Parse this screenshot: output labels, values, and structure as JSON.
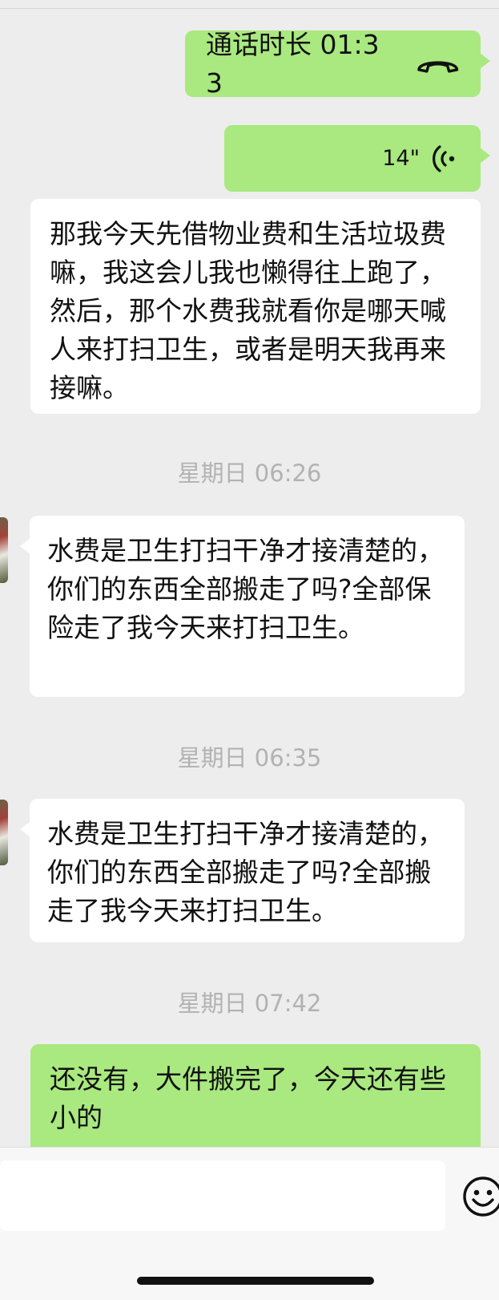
{
  "messages": {
    "call": {
      "label": "通话时长 01:33",
      "icon": "phone-hangup-icon"
    },
    "voice": {
      "duration": "14\"",
      "icon": "voice-wave-icon"
    },
    "msg1": "那我今天先借物业费和生活垃圾费嘛，我这会儿我也懒得往上跑了，然后，那个水费我就看你是哪天喊人来打扫卫生，或者是明天我再来接嘛。",
    "time1": "星期日 06:26",
    "msg2": "水费是卫生打扫干净才接清楚的，你们的东西全部搬走了吗?全部保险走了我今天来打扫卫生。",
    "time2": "星期日 06:35",
    "msg3": "水费是卫生打扫干净才接清楚的，你们的东西全部搬走了吗?全部搬走了我今天来打扫卫生。",
    "time3": "星期日 07:42",
    "msg4": "还没有，大件搬完了，今天还有些小的"
  },
  "input": {
    "value": "",
    "emoji_icon": "emoji-icon"
  },
  "colors": {
    "sent_bubble": "#a9e97f",
    "recv_bubble": "#ffffff",
    "background": "#ededed",
    "timestamp": "#b2b2b2"
  }
}
